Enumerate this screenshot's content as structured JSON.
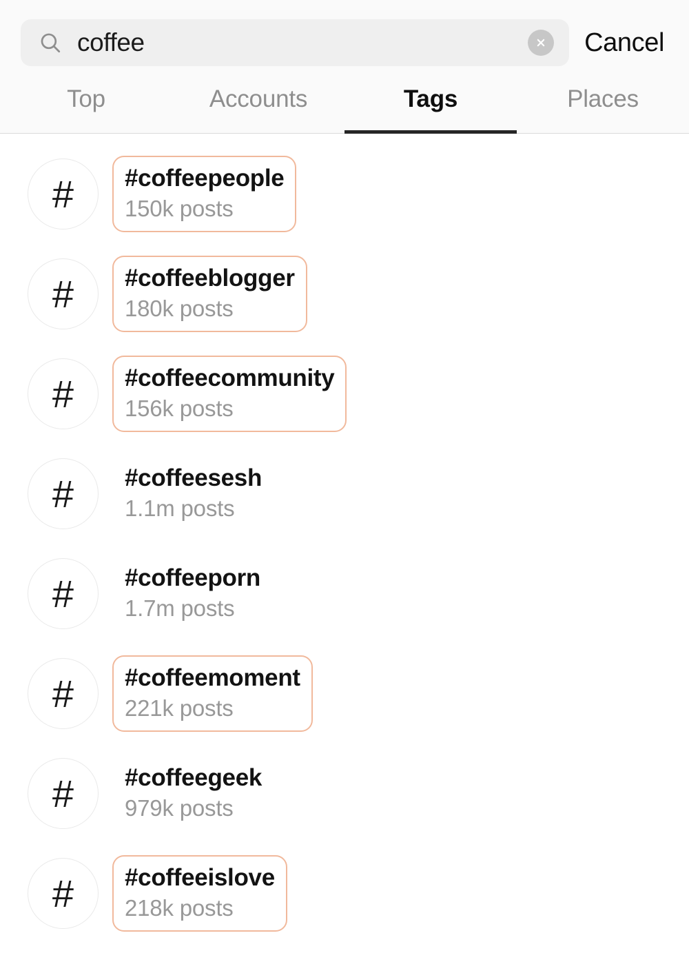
{
  "search": {
    "value": "coffee",
    "placeholder": "Search",
    "search_icon": "search-icon",
    "clear_icon": "clear-circle-icon",
    "cancel_label": "Cancel"
  },
  "tabs": {
    "active_index": 2,
    "items": [
      {
        "label": "Top"
      },
      {
        "label": "Accounts"
      },
      {
        "label": "Tags"
      },
      {
        "label": "Places"
      }
    ]
  },
  "colors": {
    "highlight_border": "#f1b99c",
    "header_bg": "#fafafa",
    "search_field_bg": "#efefef",
    "active_tab_underline": "#262626",
    "inactive_tab_text": "#8e8e8e",
    "count_text": "#989898"
  },
  "results": {
    "avatar_glyph": "#",
    "items": [
      {
        "tag": "#coffeepeople",
        "count": "150k posts",
        "highlighted": true
      },
      {
        "tag": "#coffeeblogger",
        "count": "180k posts",
        "highlighted": true
      },
      {
        "tag": "#coffeecommunity",
        "count": "156k posts",
        "highlighted": true
      },
      {
        "tag": "#coffeesesh",
        "count": "1.1m posts",
        "highlighted": false
      },
      {
        "tag": "#coffeeporn",
        "count": "1.7m posts",
        "highlighted": false
      },
      {
        "tag": "#coffeemoment",
        "count": "221k posts",
        "highlighted": true
      },
      {
        "tag": "#coffeegeek",
        "count": "979k posts",
        "highlighted": false
      },
      {
        "tag": "#coffeeislove",
        "count": "218k posts",
        "highlighted": true
      }
    ]
  }
}
